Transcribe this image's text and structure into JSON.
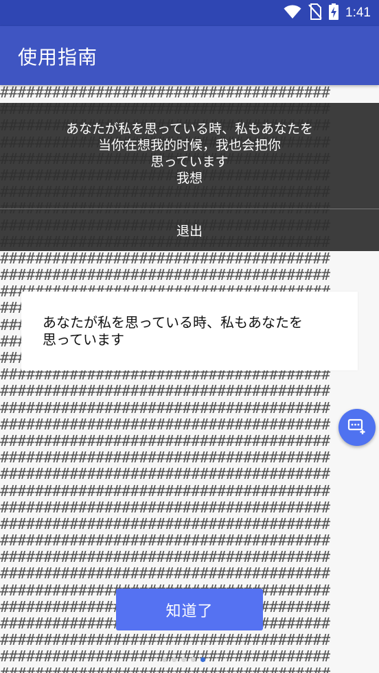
{
  "status_bar": {
    "time": "1:41",
    "icons": [
      "wifi-icon",
      "no-sim-icon",
      "battery-charging-icon"
    ]
  },
  "app_bar": {
    "title": "使用指南"
  },
  "background": {
    "hash_line": "######################################",
    "hash_line_count": 36
  },
  "dialog": {
    "message_lines": [
      "あなたが私を思っている時、私もあなたを",
      "当你在想我的时候，我也会把你",
      "思っています",
      "我想"
    ],
    "exit_label": "退出"
  },
  "card": {
    "line1": "あなたが私を思っている時、私もあなたを",
    "line2": "思っています"
  },
  "fab": {
    "icon": "add-comment-icon",
    "color": "#4f72f0"
  },
  "ok_button": {
    "label": "知道了",
    "color": "#5572f2"
  },
  "pagination": {
    "total": 5,
    "active_index": 4
  },
  "colors": {
    "status_bar": "#2f46b3",
    "app_bar": "#3f55c2",
    "dot_active": "#3a6fd8"
  }
}
